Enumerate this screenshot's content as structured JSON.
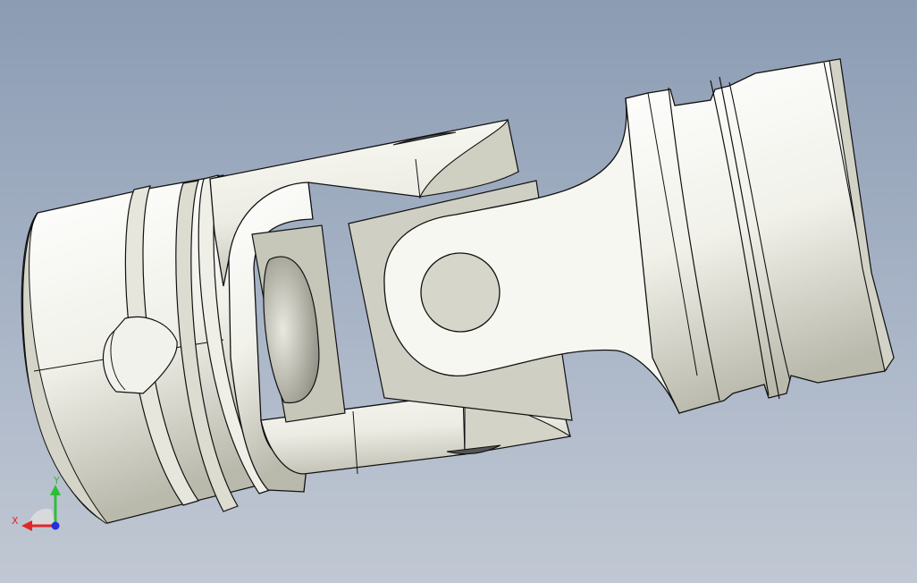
{
  "viewport": {
    "background_top": "#8b9cb3",
    "background_bottom": "#c1c8d3"
  },
  "model": {
    "part_color": "#f4f4ee",
    "shade_color": "#c9c9bc",
    "dark_shade": "#a6a698",
    "edge_color": "#111111"
  },
  "triad": {
    "x_label": "X",
    "y_label": "Y",
    "x_color": "#e0262a",
    "y_color": "#2bbf3a",
    "z_color": "#2430d8",
    "x_icon": "x-axis-arrow-icon",
    "y_icon": "y-axis-arrow-icon",
    "z_icon": "z-axis-dot-icon"
  }
}
